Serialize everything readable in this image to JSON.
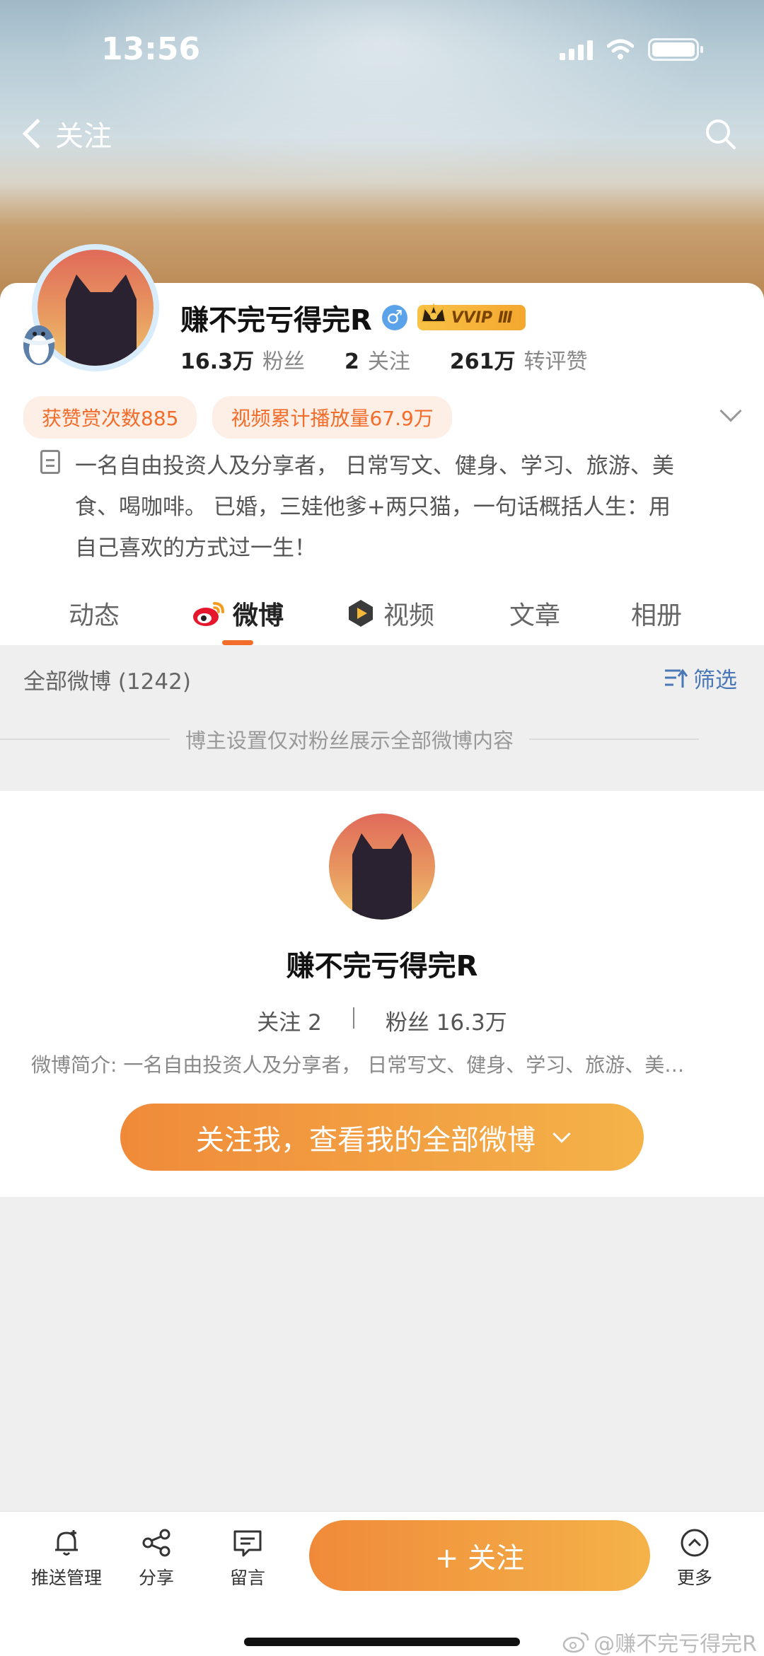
{
  "status_bar": {
    "time": "13:56"
  },
  "nav": {
    "back_label": "关注"
  },
  "profile": {
    "name": "赚不完亏得完R",
    "gender": "♂",
    "vip": "VVIP Ⅲ",
    "stats": [
      {
        "value": "16.3万",
        "label": "粉丝"
      },
      {
        "value": "2",
        "label": "关注"
      },
      {
        "value": "261万",
        "label": "转评赞"
      }
    ],
    "tags": [
      "获赞赏次数885",
      "视频累计播放量67.9万"
    ],
    "bio_lines": [
      "一名自由投资人及分享者， 日常写文、健身、学习、旅游、美",
      "食、喝咖啡。 已婚，三娃他爹+两只猫，一句话概括人生：用",
      "自己喜欢的方式过一生！"
    ]
  },
  "tabs": [
    {
      "label": "动态"
    },
    {
      "label": "微博"
    },
    {
      "label": "视频"
    },
    {
      "label": "文章"
    },
    {
      "label": "相册"
    }
  ],
  "feed": {
    "count_label": "全部微博 (1242)",
    "filter_label": "筛选",
    "notice": "博主设置仅对粉丝展示全部微博内容"
  },
  "locked": {
    "name": "赚不完亏得完R",
    "follow_label": "关注 2",
    "fans_label": "粉丝 16.3万",
    "intro": "微博简介: 一名自由投资人及分享者， 日常写文、健身、学习、旅游、美…",
    "cta": "关注我，查看我的全部微博"
  },
  "bottom_bar": {
    "push": "推送管理",
    "share": "分享",
    "message": "留言",
    "follow": "+ 关注",
    "more": "更多"
  },
  "watermark": "@赚不完亏得完R",
  "colors": {
    "accent": "#f26c2a",
    "link": "#4a77b5",
    "cta_start": "#f08a3a",
    "cta_end": "#f4b349"
  }
}
